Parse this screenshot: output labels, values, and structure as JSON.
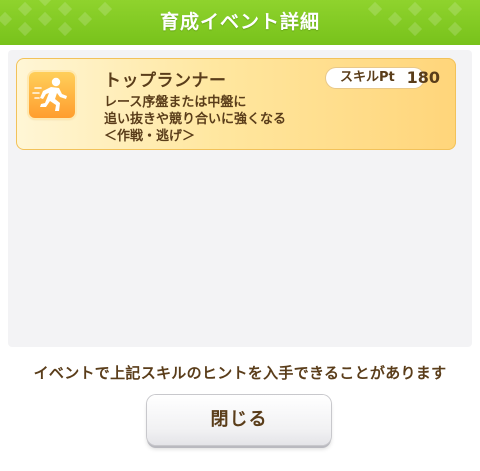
{
  "header": {
    "title": "育成イベント詳細",
    "color": "#7cc620"
  },
  "skill": {
    "name": "トップランナー",
    "pt_label": "スキルPt",
    "pt_value": "180",
    "description": [
      "レース序盤または中盤に",
      "追い抜きや競り合いに強くなる",
      "＜作戦・逃げ＞"
    ],
    "icon": "running-figure-icon",
    "card_color": "#ffe29a"
  },
  "hint": "イベントで上記スキルのヒントを入手できることがあります",
  "close_button": {
    "label": "閉じる"
  },
  "text_color": "#5a3d1a"
}
